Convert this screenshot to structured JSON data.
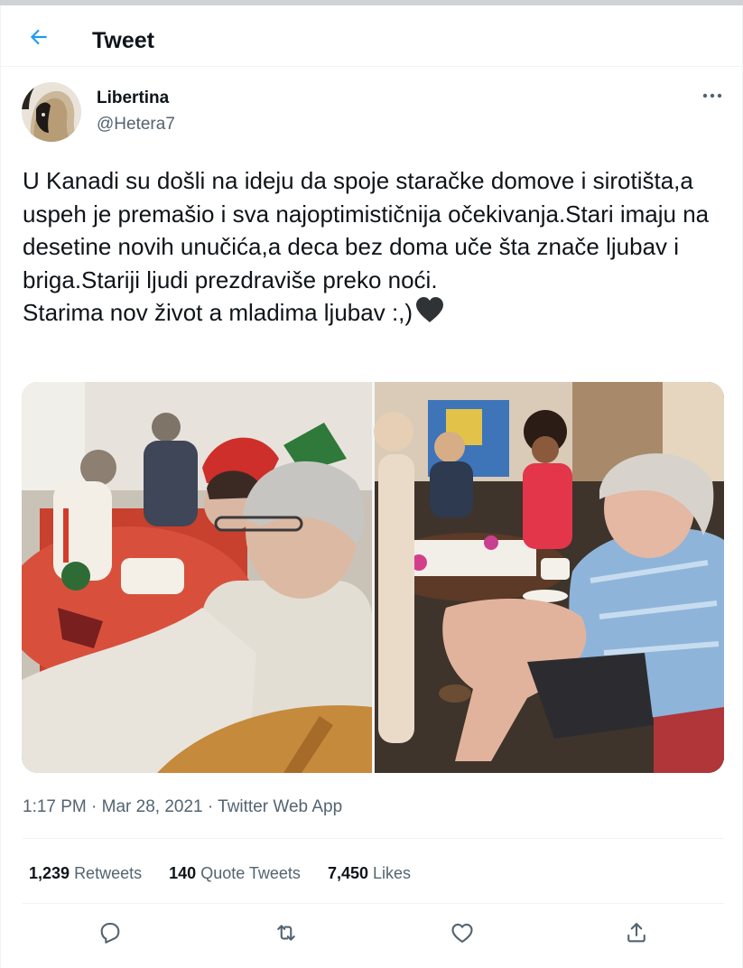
{
  "header": {
    "title": "Tweet",
    "back_icon": "arrow-left-icon"
  },
  "author": {
    "name": "Libertina",
    "handle": "@Hetera7",
    "more_icon": "more-horizontal-icon"
  },
  "tweet": {
    "text": "U Kanadi su došli na ideju da spoje staračke domove i sirotišta,a uspeh je premašio i sva najoptimističnija očekivanja.Stari imaju na desetine novih unučića,a deca bez doma uče šta znače ljubav i briga.Stariji ljudi prezdraviše preko noći.\nStarima nov život a mladima ljubav :,)",
    "emoji": "black-heart-emoji"
  },
  "meta": {
    "timestamp": "1:17 PM · Mar 28, 2021 · Twitter Web App"
  },
  "stats": {
    "retweets_count": "1,239",
    "retweets_label": "Retweets",
    "quotes_count": "140",
    "quotes_label": "Quote Tweets",
    "likes_count": "7,450",
    "likes_label": "Likes"
  },
  "actions": [
    "reply-icon",
    "retweet-icon",
    "like-icon",
    "share-icon"
  ],
  "colors": {
    "accent": "#1d9bf0",
    "text": "#0f1419",
    "secondary": "#536471",
    "divider": "#eff3f4"
  }
}
